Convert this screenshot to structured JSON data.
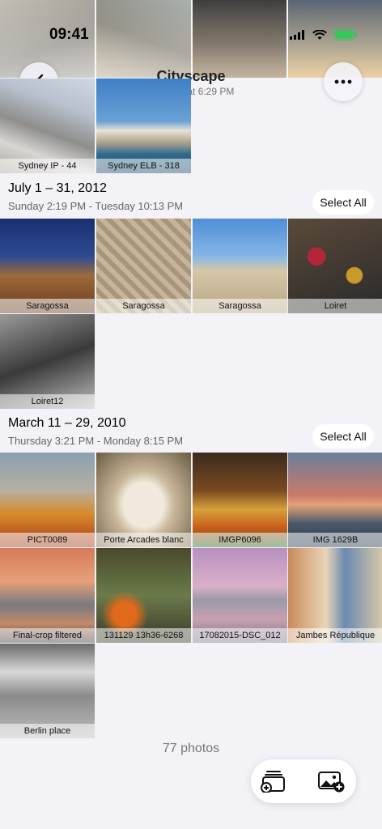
{
  "status_bar": {
    "time": "09:41"
  },
  "header": {
    "title": "Cityscape",
    "subtitle": "Updated at 6:29 PM"
  },
  "album_top": [
    {
      "caption": "Sydney IP - 44",
      "favorite": true
    },
    {
      "caption": "Sydney ELB - 318"
    }
  ],
  "sections": [
    {
      "title": "July 1 – 31, 2012",
      "subtitle": "Sunday 2:19 PM - Tuesday 10:13 PM",
      "select_label": "Select All",
      "photos": [
        "Saragossa",
        "Saragossa",
        "Saragossa",
        "Loiret",
        "Loiret12"
      ]
    },
    {
      "title": "March 11 – 29, 2010",
      "subtitle": "Thursday 3:21 PM - Monday 8:15 PM",
      "select_label": "Select All",
      "photos": [
        "PICT0089",
        "Porte Arcades blanc",
        "IMGP6096",
        "IMG 1629B",
        "Final-crop filtered",
        "131129 13h36-6268",
        "17082015-DSC_012",
        "Jambes République",
        "Berlin place"
      ]
    }
  ],
  "footer": {
    "count": "77 photos"
  },
  "icons": {
    "back": "chevron-left-icon",
    "more": "ellipsis-icon",
    "add_to_album": "add-to-album-icon",
    "add_photo": "add-photo-icon",
    "favorite": "heart-icon",
    "battery_color": "#34c759"
  }
}
